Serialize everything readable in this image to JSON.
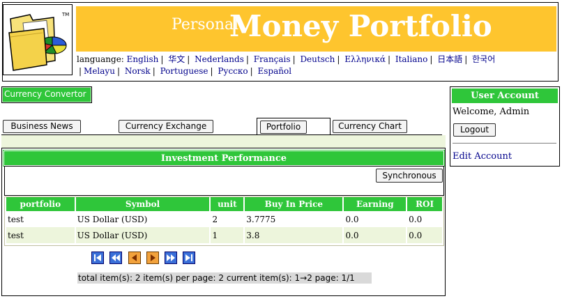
{
  "header": {
    "title_small": "Personal",
    "title_big": "Money Portfolio",
    "logo_tm": "TM",
    "language_label": "languange:",
    "languages": [
      "English",
      "华文",
      "Nederlands",
      "Français",
      "Deutsch",
      "Ελληνικά",
      "Italiano",
      "日本語",
      "한국어",
      "Melayu",
      "Norsk",
      "Portuguese",
      "Русско",
      "Español"
    ]
  },
  "convertor": {
    "label": "Currency Convertor"
  },
  "tabs": [
    {
      "label": "Business News"
    },
    {
      "label": "Currency Exchange"
    },
    {
      "label": "Portfolio"
    },
    {
      "label": "Currency Chart"
    }
  ],
  "investment": {
    "title": "Investment Performance",
    "sync_label": "Synchronous",
    "columns": [
      "portfolio",
      "Symbol",
      "unit",
      "Buy In Price",
      "Earning",
      "ROI"
    ],
    "rows": [
      [
        "test",
        "US Dollar (USD)",
        "2",
        "3.7775",
        "0.0",
        "0.0"
      ],
      [
        "test",
        "US Dollar (USD)",
        "1",
        "3.8",
        "0.0",
        "0.0"
      ]
    ],
    "pager_status": "total item(s): 2 item(s) per page: 2 current item(s): 1→2 page: 1/1"
  },
  "user_account": {
    "title": "User Account",
    "welcome": "Welcome, Admin",
    "logout_label": "Logout",
    "edit_label": "Edit Account"
  },
  "colors": {
    "accent_green": "#2fc63a",
    "banner_yellow": "#fec52e",
    "row_alt": "#edf5dc"
  }
}
